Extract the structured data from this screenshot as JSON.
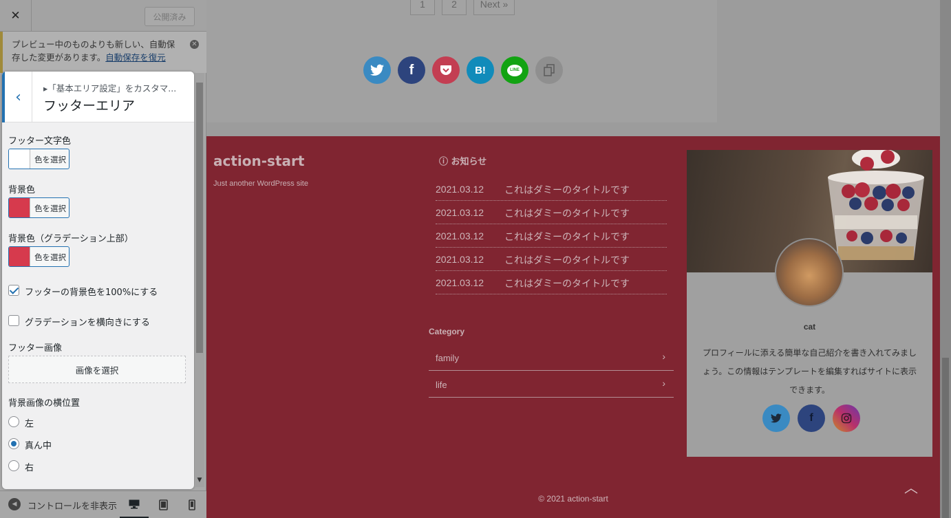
{
  "customizer": {
    "close_label": "✕",
    "publish_label": "公開済み",
    "notice": {
      "text": "プレビュー中のものよりも新しい、自動保存した変更があります。",
      "link": "自動保存を復元"
    },
    "panel": {
      "breadcrumb": "▸「基本エリア設定」をカスタマ...",
      "title": "フッターエリア"
    },
    "controls": {
      "footer_text_color_label": "フッター文字色",
      "bg_color_label": "背景色",
      "bg_gradient_top_label": "背景色（グラデーション上部）",
      "color_select_label": "色を選択",
      "footer_text_color": "#ffffff",
      "bg_color": "#d63a4d",
      "bg_gradient_color": "#d63a4d",
      "full_width_label": "フッターの背景色を100%にする",
      "full_width_checked": true,
      "gradient_horizontal_label": "グラデーションを横向きにする",
      "gradient_horizontal_checked": false,
      "footer_image_label": "フッター画像",
      "image_select_label": "画像を選択",
      "bg_position_label": "背景画像の横位置",
      "positions": [
        "左",
        "真ん中",
        "右"
      ],
      "position_selected": "真ん中"
    },
    "footer_bar": {
      "collapse_label": "コントロールを非表示"
    }
  },
  "preview": {
    "pagination": [
      "1",
      "2",
      "Next »"
    ],
    "share_buttons": [
      {
        "name": "twitter",
        "glyph": "🐦",
        "color": "#3a8ac2"
      },
      {
        "name": "facebook",
        "glyph": "f",
        "color": "#2d447d"
      },
      {
        "name": "pocket",
        "glyph": "⌄",
        "color": "#c33e52"
      },
      {
        "name": "hatena",
        "glyph": "B!",
        "color": "#118bba"
      },
      {
        "name": "line",
        "glyph": "LINE",
        "color": "#12a312"
      },
      {
        "name": "copy",
        "glyph": "⧉",
        "color": "#8f8f8f"
      }
    ],
    "footer": {
      "site_title": "action-start",
      "tagline": "Just another WordPress site",
      "news_heading": "ⓘ お知らせ",
      "news": [
        {
          "date": "2021.03.12",
          "title": "これはダミーのタイトルです"
        },
        {
          "date": "2021.03.12",
          "title": "これはダミーのタイトルです"
        },
        {
          "date": "2021.03.12",
          "title": "これはダミーのタイトルです"
        },
        {
          "date": "2021.03.12",
          "title": "これはダミーのタイトルです"
        },
        {
          "date": "2021.03.12",
          "title": "これはダミーのタイトルです"
        }
      ],
      "category_heading": "Category",
      "categories": [
        "family",
        "life"
      ],
      "profile": {
        "name": "cat",
        "description": "プロフィールに添える簡単な自己紹介を書き入れてみましょう。この情報はテンプレートを編集すればサイトに表示できます。",
        "social": [
          {
            "name": "twitter",
            "color": "#3a8ac2"
          },
          {
            "name": "facebook",
            "color": "#2d447d"
          },
          {
            "name": "instagram",
            "color": "#b8306a"
          }
        ]
      },
      "copyright": "© 2021 action-start"
    }
  }
}
